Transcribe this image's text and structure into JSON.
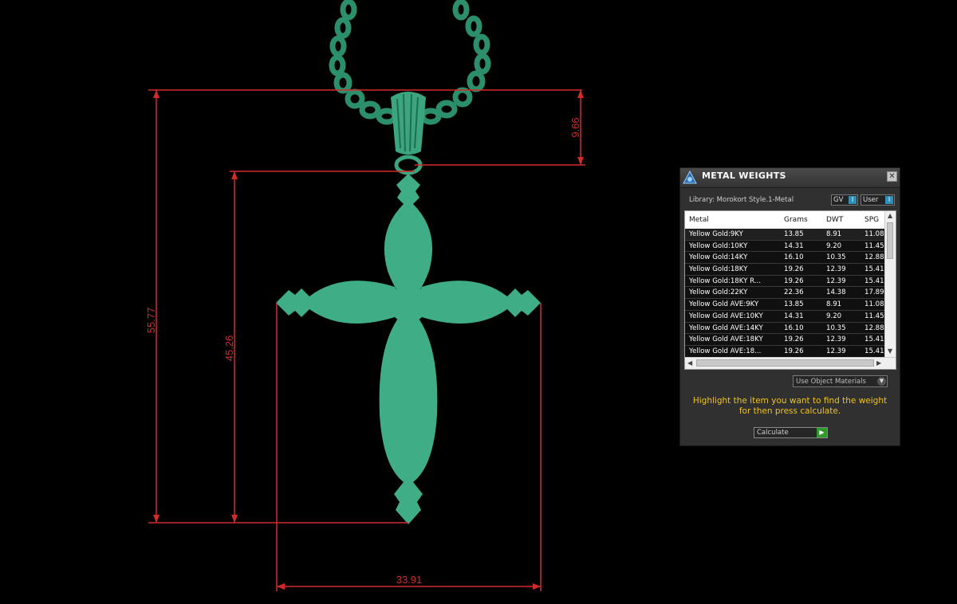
{
  "viewport": {
    "dimensions": [
      {
        "id": "total_height",
        "label": "55.77"
      },
      {
        "id": "cross_height",
        "label": "45.26"
      },
      {
        "id": "bail_height",
        "label": "9.66"
      },
      {
        "id": "width",
        "label": "33.91"
      }
    ],
    "colors": {
      "model": "#3fae86",
      "chain": "#2c8f6b",
      "dimension": "#d42a2a",
      "background": "#000000"
    }
  },
  "panel": {
    "title": "METAL WEIGHTS",
    "close_icon": "close-icon",
    "library_label": "Library: Morokort Style.1-Metal",
    "toggle_gv": {
      "label": "GV",
      "value": "I"
    },
    "toggle_user": {
      "label": "User",
      "value": "I"
    },
    "table": {
      "headers": [
        "Metal",
        "Grams",
        "DWT",
        "SPG"
      ],
      "rows": [
        [
          "Yellow Gold:9KY",
          "13.85",
          "8.91",
          "11.08"
        ],
        [
          "Yellow Gold:10KY",
          "14.31",
          "9.20",
          "11.45"
        ],
        [
          "Yellow Gold:14KY",
          "16.10",
          "10.35",
          "12.88"
        ],
        [
          "Yellow Gold:18KY",
          "19.26",
          "12.39",
          "15.41"
        ],
        [
          "Yellow Gold:18KY R...",
          "19.26",
          "12.39",
          "15.41"
        ],
        [
          "Yellow Gold:22KY",
          "22.36",
          "14.38",
          "17.89"
        ],
        [
          "Yellow Gold AVE:9KY",
          "13.85",
          "8.91",
          "11.08"
        ],
        [
          "Yellow Gold AVE:10KY",
          "14.31",
          "9.20",
          "11.45"
        ],
        [
          "Yellow Gold AVE:14KY",
          "16.10",
          "10.35",
          "12.88"
        ],
        [
          "Yellow Gold AVE:18KY",
          "19.26",
          "12.39",
          "15.41"
        ],
        [
          "Yellow Gold AVE:18...",
          "19.26",
          "12.39",
          "15.41"
        ]
      ]
    },
    "material_dropdown": "Use Object Materials",
    "hint": "Highlight the item you want to find the weight for then press calculate.",
    "calculate_label": "Calculate"
  }
}
